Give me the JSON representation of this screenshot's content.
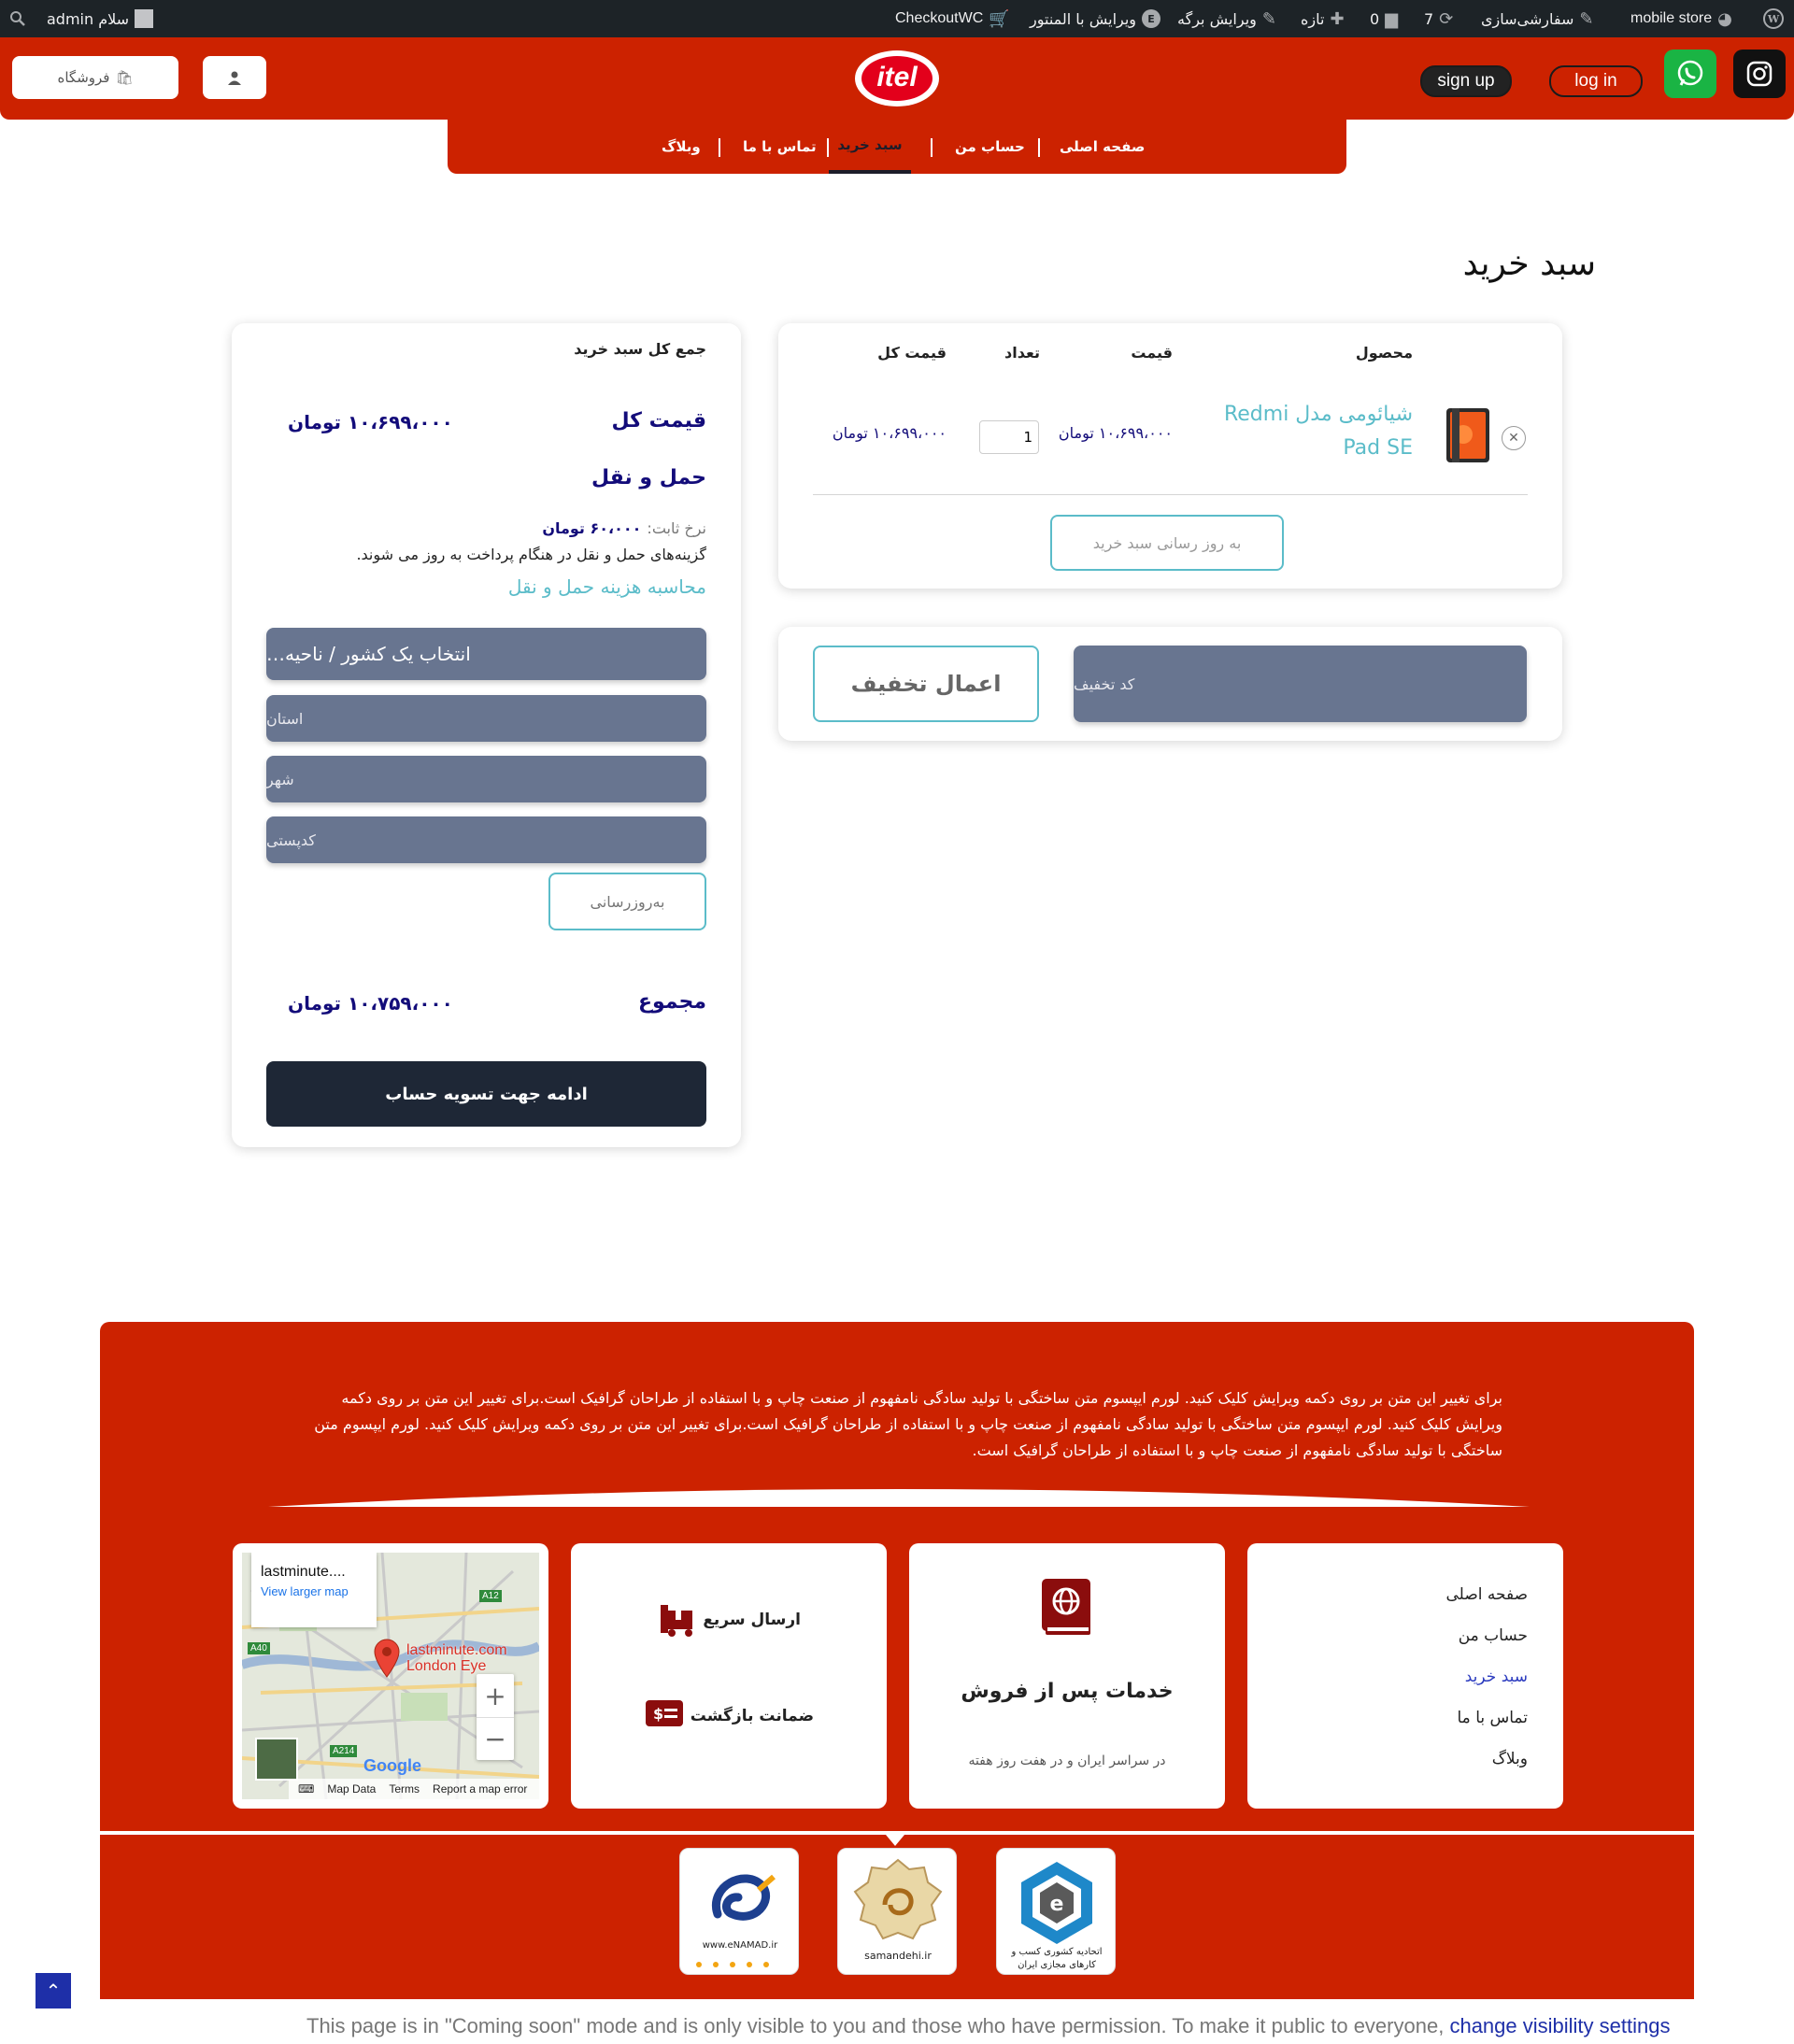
{
  "admin_bar": {
    "wp_logo": "wordpress-icon",
    "site_name": "mobile store",
    "customize": "سفارشی‌سازی",
    "updates": "7",
    "comments": "0",
    "new": "تازه",
    "edit_page": "ویرایش برگه",
    "edit_elementor": "ویرایش با المنتور",
    "checkoutwc": "CheckoutWC",
    "greeting": "سلام admin"
  },
  "header": {
    "logo": "itel",
    "shop_button": "فروشگاه",
    "user_button_icon": "user-icon",
    "signup": "sign up",
    "login": "log in",
    "whatsapp_color": "#1ab444",
    "instagram_color": "#111111",
    "brand_color": "#cc2200"
  },
  "nav": {
    "items": [
      "صفحه اصلی",
      "حساب من",
      "سبد خرید",
      "تماس با ما",
      "وبلاگ"
    ],
    "active_index": 2
  },
  "page_title": "سبد خرید",
  "cart_table": {
    "headers": {
      "product": "محصول",
      "price": "قیمت",
      "quantity": "تعداد",
      "subtotal": "قیمت کل"
    },
    "rows": [
      {
        "product_name": "شیائومی مدل Redmi Pad SE",
        "price": "۱۰،۶۹۹،۰۰۰ تومان",
        "quantity": "1",
        "subtotal": "۱۰،۶۹۹،۰۰۰ تومان"
      }
    ],
    "update_button": "به روز رسانی سبد خرید"
  },
  "coupon": {
    "placeholder": "کد تخفیف",
    "apply_button": "اعمال تخفیف"
  },
  "totals": {
    "title": "جمع کل سبد خرید",
    "subtotal_label": "قیمت کل",
    "subtotal_value": "۱۰،۶۹۹،۰۰۰ تومان",
    "shipping_title": "حمل و نقل",
    "flat_rate_label": "نرخ ثابت:",
    "flat_rate_value": "۶۰،۰۰۰ تومان",
    "shipping_note": "گزینه‌های حمل و نقل در هنگام پرداخت به روز می شوند.",
    "calc_link": "محاسبه هزینه حمل و نقل",
    "country_select": "انتخاب یک کشور / ناحیه…",
    "state_placeholder": "استان",
    "city_placeholder": "شهر",
    "postcode_placeholder": "کدپستی",
    "update_button": "به‌روزرسانی",
    "total_label": "مجموع",
    "total_value": "۱۰،۷۵۹،۰۰۰ تومان",
    "checkout_button": "ادامه جهت تسویه حساب"
  },
  "footer": {
    "lorem": "برای تغییر این متن بر روی دکمه ویرایش کلیک کنید. لورم ایپسوم متن ساختگی با تولید سادگی نامفهوم از صنعت چاپ و با استفاده از طراحان گرافیک است.برای تغییر این متن بر روی دکمه ویرایش کلیک کنید. لورم ایپسوم متن ساختگی با تولید سادگی نامفهوم از صنعت چاپ و با استفاده از طراحان گرافیک است.برای تغییر این متن بر روی دکمه ویرایش کلیک کنید. لورم ایپسوم متن ساختگی با تولید سادگی نامفهوم از صنعت چاپ و با استفاده از طراحان گرافیک است.",
    "links": [
      "صفحه اصلی",
      "حساب من",
      "سبد خرید",
      "تماس با ما",
      "وبلاگ"
    ],
    "active_link": 2,
    "service_title": "خدمات پس از فروش",
    "service_sub": "در سراسر ایران و در هفت روز هفته",
    "fast_shipping": "ارسال سریع",
    "return_guarantee": "ضمانت بازگشت",
    "map": {
      "place": "lastminute....",
      "view_larger": "View larger map",
      "pin_label_1": "lastminute.com",
      "pin_label_2": "London Eye",
      "road_a40": "A40",
      "road_a12": "A12",
      "road_a214": "A214",
      "google": "Google",
      "map_data": "Map Data",
      "terms": "Terms",
      "report": "Report a map error"
    },
    "seals": [
      {
        "name": "etehadieh",
        "text": "اتحادیه کشوری کسب و کارهای مجازی ایران"
      },
      {
        "name": "samandehi",
        "text": "samandehi.ir"
      },
      {
        "name": "enamad",
        "text": "www.eNAMAD.ir"
      }
    ]
  },
  "coming_soon": {
    "text": "This page is in \"Coming soon\" mode and is only visible to you and those who have permission. To make it public to everyone,",
    "link": "change visibility settings"
  }
}
